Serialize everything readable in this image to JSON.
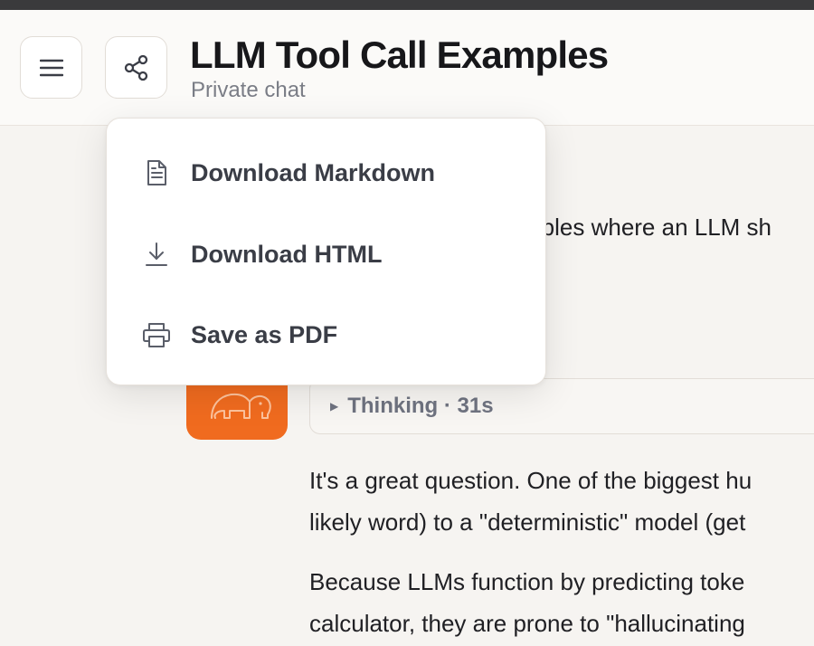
{
  "header": {
    "title": "LLM Tool Call Examples",
    "subtitle": "Private chat",
    "menu_icon": "hamburger-icon",
    "share_icon": "share-icon"
  },
  "dropdown": {
    "items": [
      {
        "label": "Download Markdown",
        "icon": "document-icon"
      },
      {
        "label": "Download HTML",
        "icon": "download-icon"
      },
      {
        "label": "Save as PDF",
        "icon": "printer-icon"
      }
    ]
  },
  "chat": {
    "user_fragment": "mples where an LLM sh",
    "assistant_avatar_icon": "elephant-logo-icon",
    "thinking_label": "Thinking · 31s",
    "paragraph1_line1": "It's a great question. One of the biggest hu",
    "paragraph1_line2": "likely word) to a \"deterministic\" model (get",
    "paragraph2_line1": "Because LLMs function by predicting toke",
    "paragraph2_line2": "calculator, they are prone to \"hallucinating"
  },
  "colors": {
    "accent": "#f06b1f",
    "background": "#f6f4f1",
    "header_background": "#fbfaf8"
  }
}
